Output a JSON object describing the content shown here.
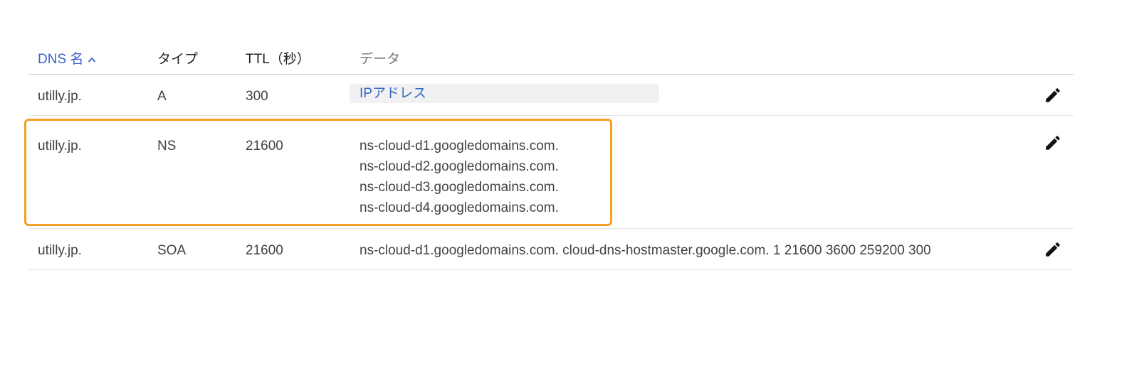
{
  "table": {
    "headers": {
      "dns_name": "DNS 名",
      "type": "タイプ",
      "ttl": "TTL（秒）",
      "data": "データ"
    },
    "sort": {
      "column": "dns_name",
      "direction": "ascending",
      "icon": "chevron-up-icon"
    },
    "rows": [
      {
        "name": "utilly.jp.",
        "type": "A",
        "ttl": "300",
        "data": [
          "IPアドレス"
        ],
        "edit_icon": "pencil-icon"
      },
      {
        "name": "utilly.jp.",
        "type": "NS",
        "ttl": "21600",
        "data": [
          "ns-cloud-d1.googledomains.com.",
          "ns-cloud-d2.googledomains.com.",
          "ns-cloud-d3.googledomains.com.",
          "ns-cloud-d4.googledomains.com."
        ],
        "highlighted": true,
        "edit_icon": "pencil-icon"
      },
      {
        "name": "utilly.jp.",
        "type": "SOA",
        "ttl": "21600",
        "data": [
          "ns-cloud-d1.googledomains.com. cloud-dns-hostmaster.google.com. 1 21600 3600 259200 300"
        ],
        "edit_icon": "pencil-icon"
      }
    ]
  },
  "colors": {
    "accent": "#3b63c9",
    "link": "#3367c4",
    "highlight_border": "#f4a025",
    "chip_background": "#f1f1f1"
  }
}
